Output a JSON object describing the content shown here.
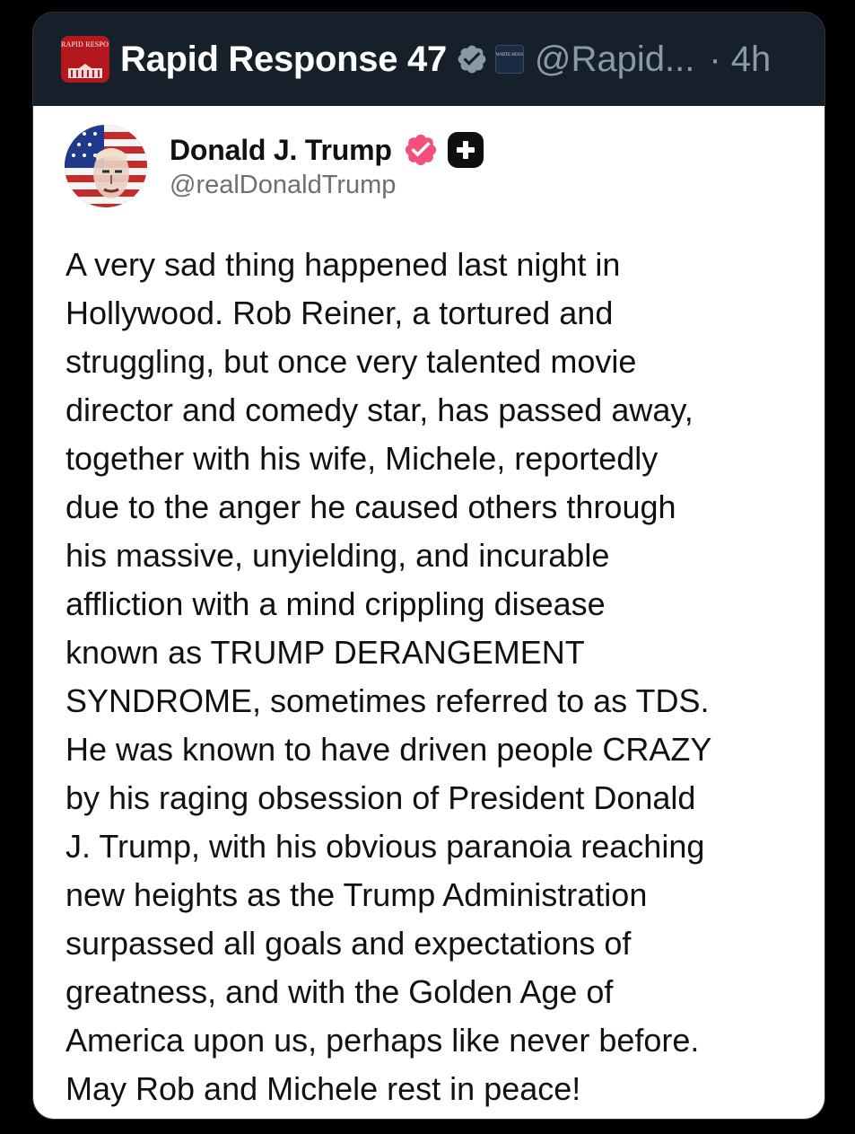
{
  "header": {
    "account_name": "Rapid Response 47",
    "logo_text": "RAPID RESPONSE",
    "affiliate_badge_text": "WHITE HOUSE",
    "handle": "@Rapid...",
    "timestamp": "· 4h",
    "icons": [
      "rapid-response-logo",
      "verified-badge-gray",
      "white-house-affiliate-badge"
    ]
  },
  "embedded_post": {
    "author_name": "Donald J. Trump",
    "author_handle": "@realDonaldTrump",
    "icons": [
      "avatar-image",
      "verified-badge-pink",
      "plus-badge"
    ],
    "body_lines": [
      "A very sad thing happened last night in",
      "Hollywood. Rob Reiner, a tortured and",
      "struggling, but once very talented movie",
      "director and comedy star, has passed away,",
      "together with his wife, Michele, reportedly",
      "due to the anger he caused others through",
      "his massive, unyielding, and incurable",
      "affliction with a mind crippling disease",
      "known as TRUMP DERANGEMENT",
      "SYNDROME, sometimes referred to as TDS.",
      "He was known to have driven people CRAZY",
      "by his raging obsession of President Donald",
      "J. Trump, with his obvious paranoia reaching",
      "new heights as the Trump Administration",
      "surpassed all goals and expectations of",
      "greatness, and with the Golden Age of",
      "America upon us, perhaps like never before.",
      "May Rob and Michele rest in peace!"
    ]
  },
  "colors": {
    "page_background": "#000000",
    "header_background": "#16202a",
    "card_background": "#ffffff",
    "primary_text_dark": "#111111",
    "secondary_text": "#8b98a5",
    "verified_pink": "#f0507a",
    "verified_gray": "#8b98a5",
    "logo_red": "#b3181d"
  }
}
